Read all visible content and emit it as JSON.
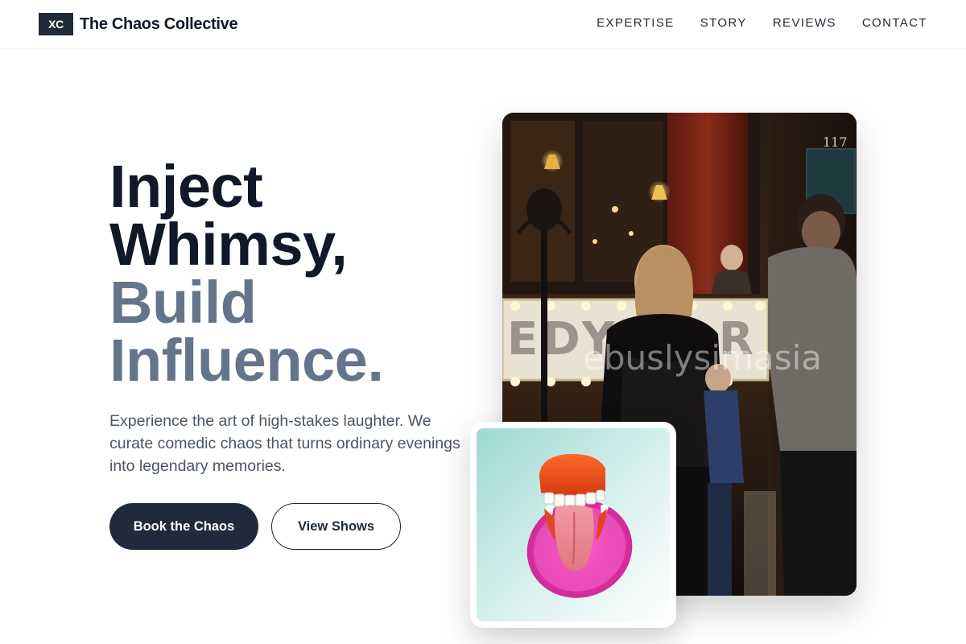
{
  "brand": {
    "mark": "XC",
    "name": "The Chaos Collective"
  },
  "nav": {
    "items": [
      "EXPERTISE",
      "STORY",
      "REVIEWS",
      "CONTACT"
    ]
  },
  "hero": {
    "headline": {
      "line1": "Inject",
      "line2": "Whimsy,",
      "line3": "Build",
      "line4": "Influence."
    },
    "lead": "Experience the art of high-stakes laughter. We curate comedic chaos that turns ordinary evenings into legendary memories.",
    "primary_cta": "Book the Chaos",
    "secondary_cta": "View Shows"
  },
  "media": {
    "main_photo_watermark": "ebuslysimasia",
    "main_photo_sign": "EDY BAR",
    "main_photo_number": "117"
  },
  "colors": {
    "accent_dark": "#1f2a3c",
    "headline_dark": "#111827",
    "headline_muted": "#64748b"
  }
}
